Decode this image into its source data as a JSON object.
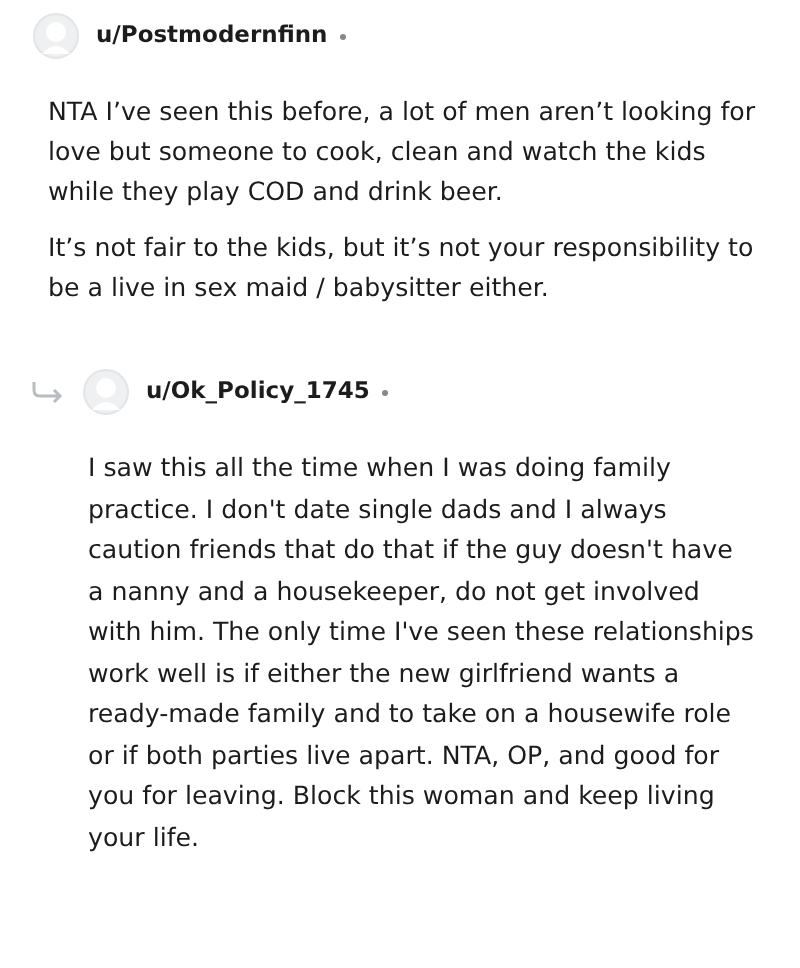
{
  "comments": [
    {
      "username": "u/Postmodernfinn",
      "is_reply": false,
      "paragraphs": [
        "NTA I’ve seen this before, a lot of men aren’t looking for love but someone to cook, clean and watch the kids while they play COD and drink beer.",
        "It’s not fair to the kids, but it’s not your responsibility to be a live in sex maid / babysitter either."
      ]
    },
    {
      "username": "u/Ok_Policy_1745",
      "is_reply": true,
      "paragraphs": [
        "I saw this all the time when I was doing family practice. I don't date single dads and I always caution friends that do that if the guy doesn't have a nanny and a housekeeper, do not get involved with him. The only time I've seen these relationships work well is if either the new girlfriend wants a ready-made family and to take on a housewife role or if both parties live apart. NTA, OP, and good for you for leaving. Block this woman and keep living your life."
      ]
    }
  ]
}
